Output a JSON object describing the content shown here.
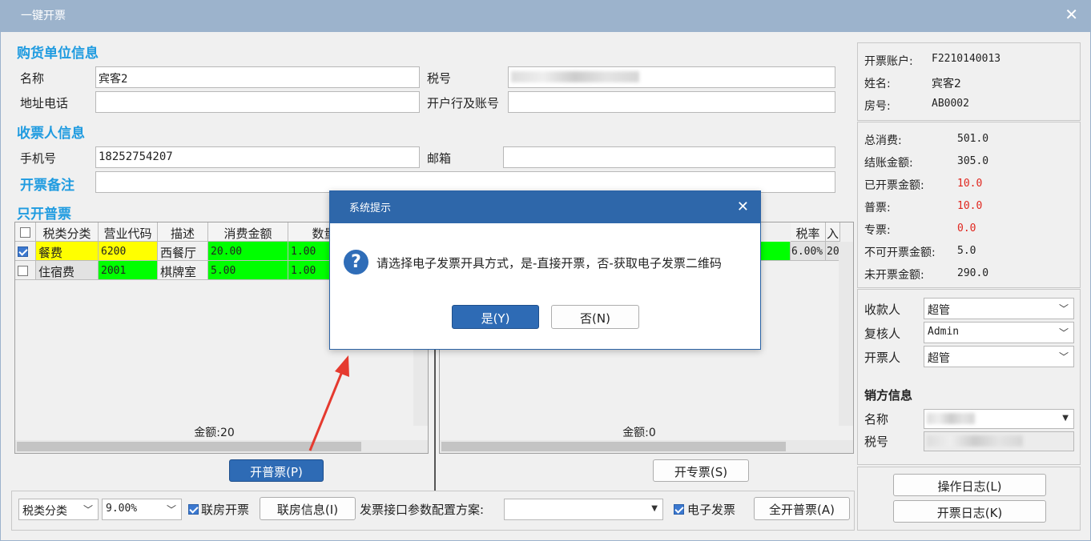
{
  "window": {
    "title": "一键开票",
    "close": "✕"
  },
  "buyer": {
    "section": "购货单位信息",
    "name_label": "名称",
    "name_value": "宾客2",
    "taxno_label": "税号",
    "address_label": "地址电话",
    "bank_label": "开户行及账号"
  },
  "receiver": {
    "section": "收票人信息",
    "phone_label": "手机号",
    "phone_value": "18252754207",
    "email_label": "邮箱",
    "remark_label": "开票备注"
  },
  "only_normal": "只开普票",
  "left_table": {
    "headers": [
      "税类分类",
      "营业代码",
      "描述",
      "消费金额",
      "数量"
    ],
    "rows": [
      {
        "cat": "餐费",
        "code": "6200",
        "desc": "西餐厅",
        "amount": "20.00",
        "qty": "1.00",
        "checked": true
      },
      {
        "cat": "住宿费",
        "code": "2001",
        "desc": "棋牌室",
        "amount": "5.00",
        "qty": "1.00",
        "checked": false
      }
    ],
    "total": "金额:20"
  },
  "right_table": {
    "headers": [
      "税率",
      "入"
    ],
    "row": {
      "rate": "6.00%",
      "extra": "20"
    },
    "total": "金额:0"
  },
  "buttons": {
    "normal_invoice": "开普票(P)",
    "special_invoice": "开专票(S)",
    "room_info": "联房信息(I)",
    "all_normal": "全开普票(A)",
    "op_log": "操作日志(L)",
    "invoice_log": "开票日志(K)"
  },
  "bottom": {
    "tax_category": "税类分类",
    "rate": "9.00%",
    "linked_room": "联房开票",
    "config_label": "发票接口参数配置方案:",
    "e_invoice": "电子发票"
  },
  "account": {
    "account_label": "开票账户:",
    "account_value": "F2210140013",
    "name_label": "姓名:",
    "name_value": "宾客2",
    "room_label": "房号:",
    "room_value": "AB0002"
  },
  "amounts": [
    {
      "label": "总消费:",
      "value": "501.0",
      "color": "#222222"
    },
    {
      "label": "结账金额:",
      "value": "305.0",
      "color": "#222222"
    },
    {
      "label": "已开票金额:",
      "value": "10.0",
      "color": "#e0261e"
    },
    {
      "label": "普票:",
      "value": "10.0",
      "color": "#e0261e"
    },
    {
      "label": "专票:",
      "value": "0.0",
      "color": "#e0261e"
    },
    {
      "label": "不可开票金额:",
      "value": "5.0",
      "color": "#222222"
    },
    {
      "label": "未开票金额:",
      "value": "290.0",
      "color": "#222222"
    }
  ],
  "people": {
    "payee_label": "收款人",
    "payee_value": "超管",
    "reviewer_label": "复核人",
    "reviewer_value": "Admin",
    "drawer_label": "开票人",
    "drawer_value": "超管"
  },
  "seller": {
    "section": "销方信息",
    "name_label": "名称",
    "taxno_label": "税号"
  },
  "dialog": {
    "title": "系统提示",
    "message": "请选择电子发票开具方式，是-直接开票，否-获取电子发票二维码",
    "yes": "是(Y)",
    "no": "否(N)"
  },
  "icons": {
    "question": "question-icon",
    "check": "checkbox-checked-icon",
    "dropdown": "chevron-down-icon"
  },
  "colors": {
    "title_bar": "#9cb3cc",
    "dialog_title": "#2e67aa",
    "yellow": "#ffff00",
    "green": "#00ff00",
    "red": "#e0261e",
    "section": "#1f9be0"
  }
}
